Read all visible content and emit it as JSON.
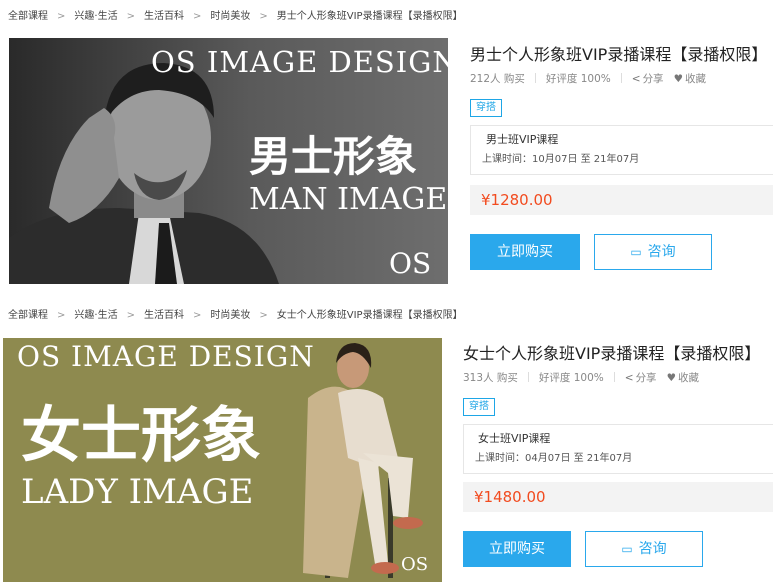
{
  "breadcrumb": {
    "items": [
      "全部课程",
      "兴趣·生活",
      "生活百科",
      "时尚美妆"
    ],
    "separator": ">"
  },
  "products": [
    {
      "page_title": "男士个人形象班VIP录播课程【录播权限】",
      "banner": {
        "heading": "OS IMAGE DESIGN",
        "cn_title": "男士形象",
        "en_title": "MAN IMAGE",
        "logo": "OS",
        "bg_color": "#3c3c3c"
      },
      "title": "男士个人形象班VIP录播课程【录播权限】",
      "purchases": "212人 购买",
      "rating": "好评度 100%",
      "share_label": "分享",
      "favorite_label": "收藏",
      "tag": "穿搭",
      "plan_name": "男士班VIP课程",
      "plan_time": "上课时间：10月07日 至 21年07月",
      "price": "¥1280.00",
      "buy_label": "立即购买",
      "ask_label": "咨询"
    },
    {
      "page_title": "女士个人形象班VIP录播课程【录播权限】",
      "banner": {
        "heading": "OS IMAGE DESIGN",
        "cn_title": "女士形象",
        "en_title": "LADY IMAGE",
        "logo": "OS",
        "bg_color": "#8e8a4f"
      },
      "title": "女士个人形象班VIP录播课程【录播权限】",
      "purchases": "313人 购买",
      "rating": "好评度 100%",
      "share_label": "分享",
      "favorite_label": "收藏",
      "tag": "穿搭",
      "plan_name": "女士班VIP课程",
      "plan_time": "上课时间：04月07日 至 21年07月",
      "price": "¥1480.00",
      "buy_label": "立即购买",
      "ask_label": "咨询"
    }
  ],
  "icons": {
    "share": "share-icon",
    "favorite": "heart-icon",
    "ask": "chat-icon"
  },
  "colors": {
    "accent": "#2aa8ec",
    "price": "#f24b1f"
  }
}
